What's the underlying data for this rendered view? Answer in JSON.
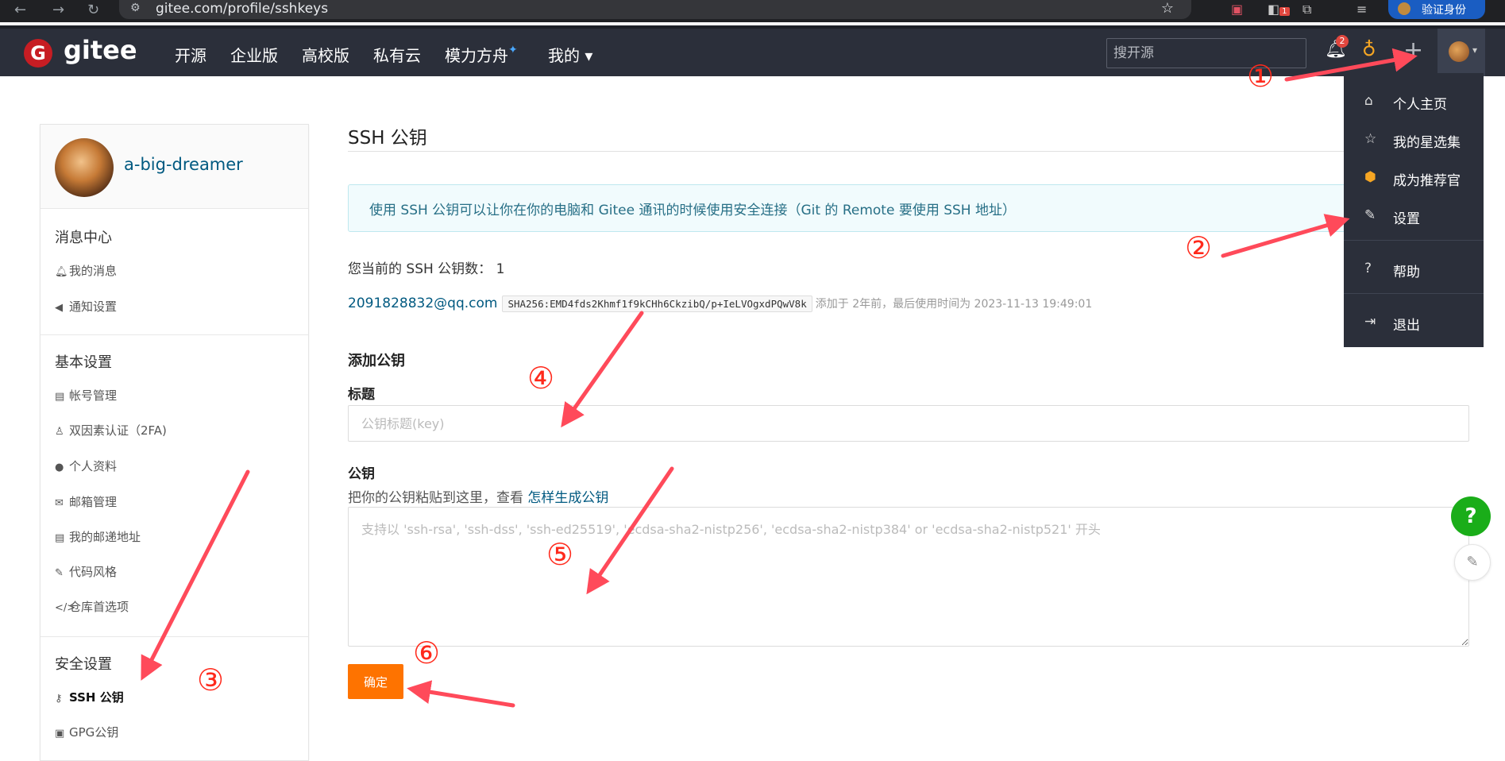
{
  "browser": {
    "url": "gitee.com/profile/sshkeys",
    "verify_label": "验证身份",
    "ext_badge": "1"
  },
  "header": {
    "logo_text": "gitee",
    "nav": [
      "开源",
      "企业版",
      "高校版",
      "私有云",
      "模力方舟",
      "我的 ▾"
    ],
    "search_placeholder": "搜开源",
    "bell_badge": "2"
  },
  "dropdown": {
    "items": [
      "个人主页",
      "我的星选集",
      "成为推荐官",
      "设置",
      "帮助",
      "退出"
    ]
  },
  "sidebar": {
    "username": "a-big-dreamer",
    "sections": [
      {
        "title": "消息中心",
        "items": [
          "我的消息",
          "通知设置"
        ]
      },
      {
        "title": "基本设置",
        "items": [
          "帐号管理",
          "双因素认证（2FA)",
          "个人资料",
          "邮箱管理",
          "我的邮递地址",
          "代码风格",
          "仓库首选项"
        ]
      },
      {
        "title": "安全设置",
        "items": [
          "SSH 公钥",
          "GPG公钥"
        ]
      }
    ]
  },
  "main": {
    "title": "SSH 公钥",
    "info": "使用 SSH 公钥可以让你在你的电脑和 Gitee 通讯的时候使用安全连接（Git 的 Remote 要使用 SSH 地址）",
    "count_text": "您当前的 SSH 公钥数：  1",
    "key": {
      "email": "2091828832@qq.com",
      "fingerprint": "SHA256:EMD4fds2Khmf1f9kCHh6CkzibQ/p+IeLVOgxdPQwV8k",
      "meta": "添加于 2年前，最后使用时间为 2023-11-13 19:49:01"
    },
    "add_heading": "添加公钥",
    "title_label": "标题",
    "title_placeholder": "公钥标题(key)",
    "key_label": "公钥",
    "hint_prefix": "把你的公钥粘贴到这里，查看 ",
    "hint_link": "怎样生成公钥",
    "key_placeholder": "支持以 'ssh-rsa', 'ssh-dss', 'ssh-ed25519', 'ecdsa-sha2-nistp256', 'ecdsa-sha2-nistp384' or 'ecdsa-sha2-nistp521' 开头",
    "confirm_label": "确定"
  },
  "annotations": [
    "①",
    "②",
    "③",
    "④",
    "⑤",
    "⑥"
  ]
}
